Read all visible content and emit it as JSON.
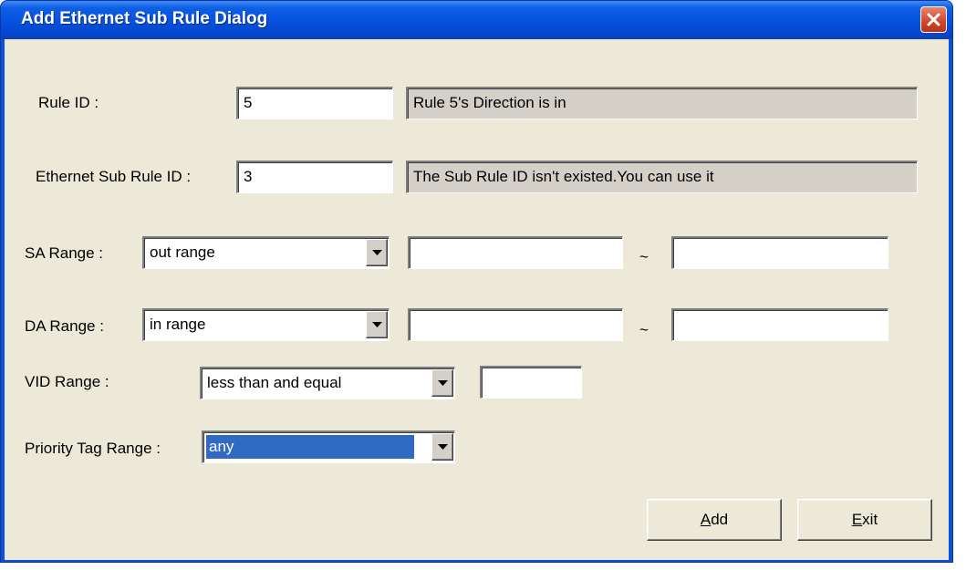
{
  "dialog": {
    "title": "Add Ethernet Sub Rule Dialog",
    "close_icon": "close-icon"
  },
  "rule_id": {
    "label": "Rule ID :",
    "value": "5",
    "status": "Rule 5's Direction is in"
  },
  "sub_rule_id": {
    "label": "Ethernet Sub Rule ID :",
    "value": "3",
    "status": "The Sub Rule ID isn't existed.You can use it"
  },
  "sa_range": {
    "label": "SA Range :",
    "selected": "out range",
    "from": "",
    "to": "",
    "separator": "~"
  },
  "da_range": {
    "label": "DA Range :",
    "selected": "in range",
    "from": "",
    "to": "",
    "separator": "~"
  },
  "vid_range": {
    "label": "VID Range :",
    "selected": "less than and equal",
    "value": ""
  },
  "priority_tag_range": {
    "label": "Priority Tag Range :",
    "selected": "any"
  },
  "buttons": {
    "add_mnemonic": "A",
    "add_rest": "dd",
    "exit_mnemonic": "E",
    "exit_rest": "xit"
  },
  "colors": {
    "titlebar": "#0553e0",
    "client_background": "#ece9d8",
    "readonly_background": "#d4d0c8",
    "selection": "#316ac5"
  }
}
